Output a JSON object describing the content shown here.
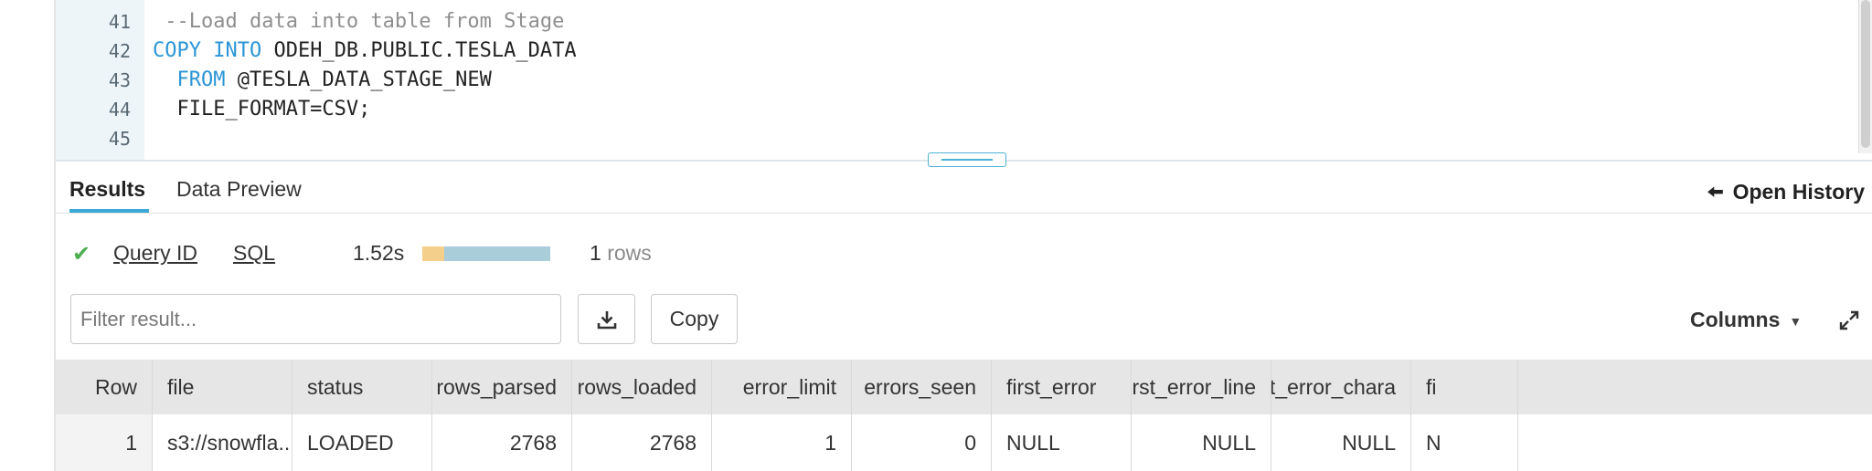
{
  "editor": {
    "lines": [
      {
        "num": "41",
        "tokens": [
          {
            "t": " --Load data into table from Stage",
            "c": "cm"
          }
        ]
      },
      {
        "num": "42",
        "tokens": [
          {
            "t": "COPY INTO",
            "c": "kw"
          },
          {
            "t": " ODEH_DB.PUBLIC.TESLA_DATA",
            "c": "tx"
          }
        ]
      },
      {
        "num": "43",
        "tokens": [
          {
            "t": "  ",
            "c": "tx"
          },
          {
            "t": "FROM",
            "c": "kw"
          },
          {
            "t": " @TESLA_DATA_STAGE_NEW",
            "c": "tx"
          }
        ]
      },
      {
        "num": "44",
        "tokens": [
          {
            "t": "  FILE_FORMAT=CSV;",
            "c": "tx"
          }
        ]
      },
      {
        "num": "45",
        "tokens": []
      }
    ]
  },
  "tabs": {
    "results": "Results",
    "data_preview": "Data Preview",
    "open_history": "Open History",
    "open_history_icon": "arrow-left-icon"
  },
  "query_info": {
    "status_icon": "check-icon",
    "query_id": "Query ID",
    "sql": "SQL",
    "duration": "1.52s",
    "compile_fraction": 0.17,
    "row_count": "1",
    "row_unit": "rows"
  },
  "toolbar": {
    "filter_placeholder": "Filter result...",
    "download_icon": "download-icon",
    "copy_label": "Copy",
    "columns_label": "Columns",
    "columns_caret": "▼",
    "expand_icon": "expand-icon"
  },
  "table": {
    "headers": [
      "Row",
      "file",
      "status",
      "rows_parsed",
      "rows_loaded",
      "error_limit",
      "errors_seen",
      "first_error",
      "first_error_line",
      "first_error_chara",
      "fi"
    ],
    "rows": [
      [
        "1",
        "s3://snowfla...",
        "LOADED",
        "2768",
        "2768",
        "1",
        "0",
        "NULL",
        "NULL",
        "NULL",
        "N"
      ]
    ]
  },
  "colors": {
    "accent": "#3aa9d8",
    "keyword": "#2b95d6",
    "comment": "#8f8f8f",
    "success": "#4caf50",
    "bar_compile": "#f3cf8b",
    "bar_exec": "#a9cdd9"
  }
}
